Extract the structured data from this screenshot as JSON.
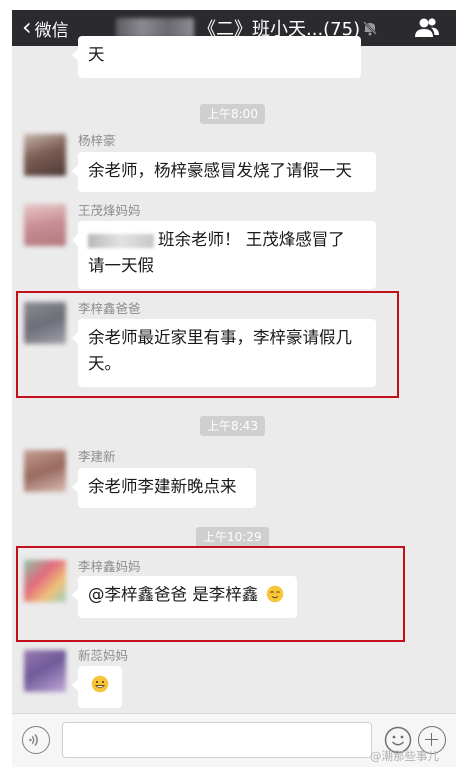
{
  "navbar": {
    "back_label": "微信",
    "title": "《二》班小天...(75)"
  },
  "timestamps": [
    "上午8:00",
    "上午8:43",
    "上午10:29"
  ],
  "messages": [
    {
      "sender": "",
      "text": "天"
    },
    {
      "sender": "杨梓豪",
      "text": "余老师，杨梓豪感冒发烧了请假一天"
    },
    {
      "sender": "王茂烽妈妈",
      "line1": "班余老师！ 王茂烽感冒了",
      "line2": "请一天假"
    },
    {
      "sender": "李梓鑫爸爸",
      "line1": "余老师最近家里有事，李梓豪请假几",
      "line2": "天。"
    },
    {
      "sender": "李建新",
      "text": "余老师李建新晚点来"
    },
    {
      "sender": "李梓鑫妈妈",
      "text": "@李梓鑫爸爸 是李梓鑫"
    },
    {
      "sender": "新蕊妈妈",
      "text": ""
    }
  ],
  "icons": {
    "back": "chevron-left-icon",
    "mute": "bell-muted-icon",
    "group_info": "people-icon",
    "voice": "voice-icon",
    "emoji": "emoji-icon",
    "more": "plus-icon"
  },
  "watermark": "@潮那些事儿",
  "colors": {
    "navbar": "#2b2b2f",
    "chat_background": "#ebebeb",
    "bubble": "#ffffff",
    "highlight": "#c0101a",
    "timestamp_pill": "#cfcfcf"
  }
}
